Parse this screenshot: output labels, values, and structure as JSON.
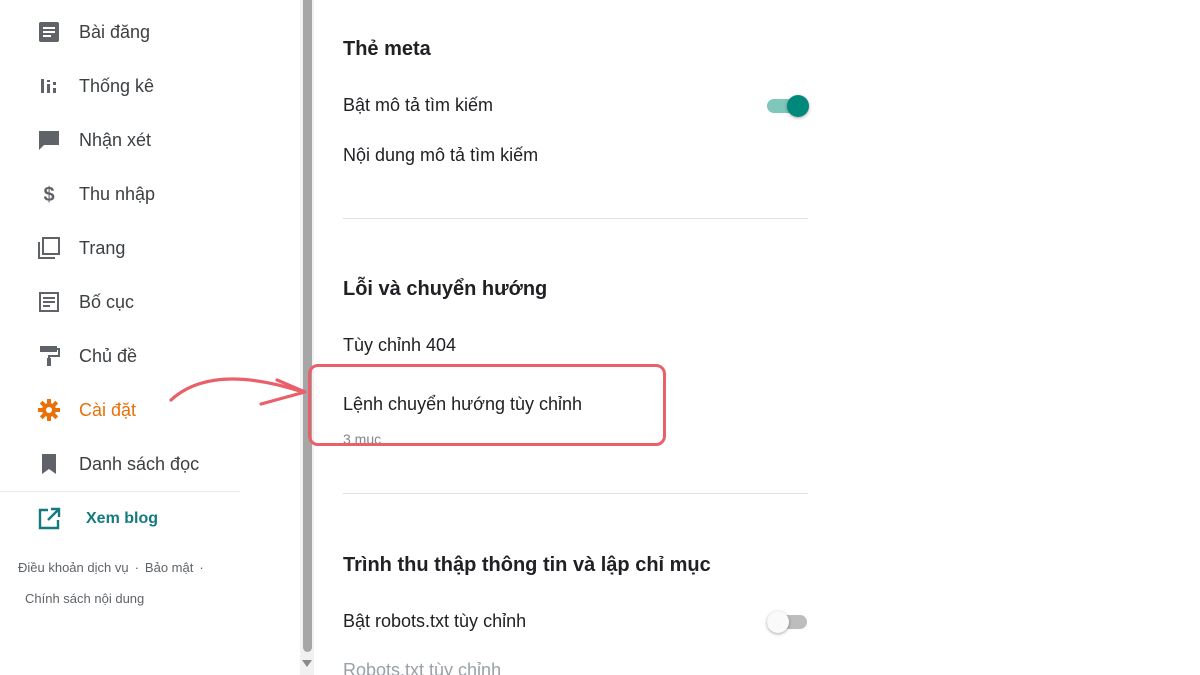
{
  "sidebar": {
    "items": [
      {
        "label": "Bài đăng",
        "icon": "posts-icon"
      },
      {
        "label": "Thống kê",
        "icon": "stats-icon"
      },
      {
        "label": "Nhận xét",
        "icon": "comment-icon"
      },
      {
        "label": "Thu nhập",
        "icon": "dollar-icon"
      },
      {
        "label": "Trang",
        "icon": "pages-icon"
      },
      {
        "label": "Bố cục",
        "icon": "layout-icon"
      },
      {
        "label": "Chủ đề",
        "icon": "paint-roller-icon"
      },
      {
        "label": "Cài đặt",
        "icon": "gear-icon",
        "active": true
      },
      {
        "label": "Danh sách đọc",
        "icon": "bookmark-icon"
      }
    ],
    "view_blog": {
      "label": "Xem blog",
      "icon": "open-in-new-icon"
    },
    "footer": {
      "terms": "Điều khoản dịch vụ",
      "privacy": "Bảo mật",
      "content_policy": "Chính sách nội dung",
      "separator": "·"
    }
  },
  "main": {
    "meta": {
      "title": "Thẻ meta",
      "enable_search_description": {
        "label": "Bật mô tả tìm kiếm",
        "enabled": true
      },
      "search_description_content": "Nội dung mô tả tìm kiếm"
    },
    "errors": {
      "title": "Lỗi và chuyển hướng",
      "custom_404": "Tùy chỉnh 404",
      "custom_redirects": {
        "label": "Lệnh chuyển hướng tùy chỉnh",
        "sub": "3 mục"
      }
    },
    "crawlers": {
      "title": "Trình thu thập thông tin và lập chỉ mục",
      "enable_custom_robots": {
        "label": "Bật robots.txt tùy chỉnh",
        "enabled": false
      },
      "custom_robots": "Robots.txt tùy chỉnh"
    }
  },
  "colors": {
    "accent_active": "#e8710a",
    "toggle_on": "#00897b",
    "link_teal": "#137a7f",
    "annotation": "#e9606b"
  }
}
